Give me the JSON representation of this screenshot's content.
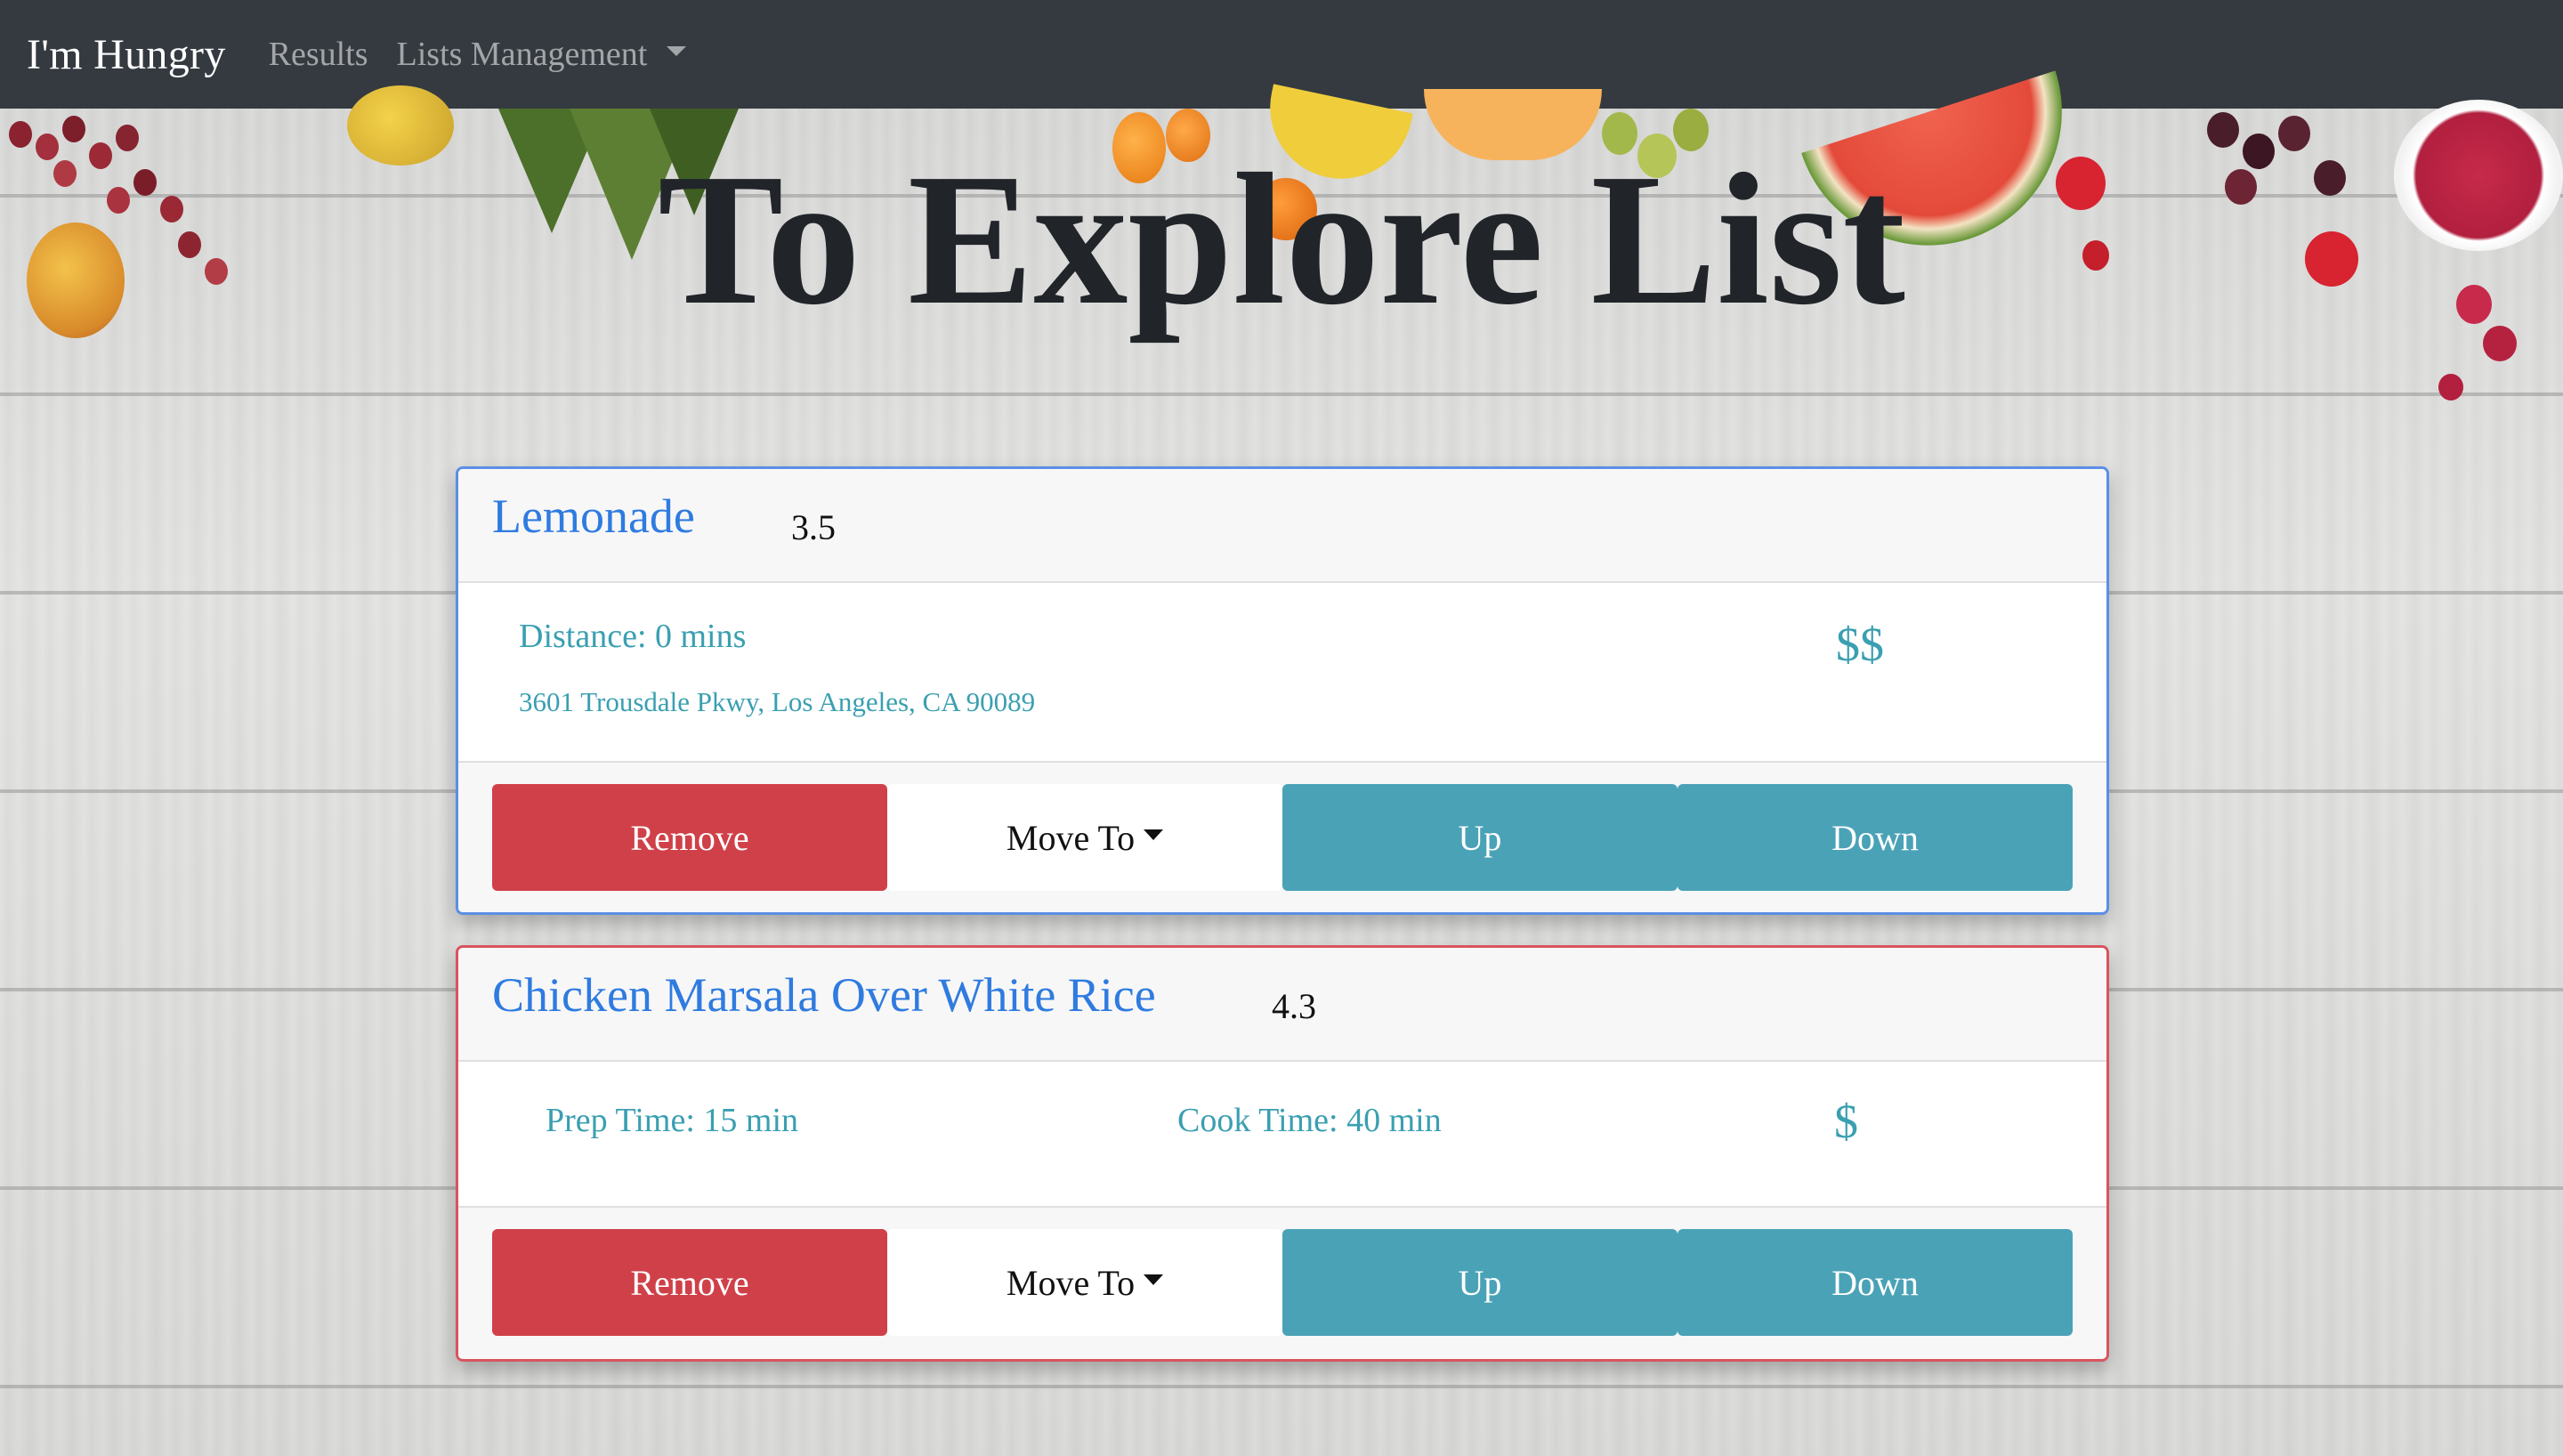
{
  "navbar": {
    "brand": "I'm Hungry",
    "links": [
      "Results",
      "Lists Management"
    ]
  },
  "page": {
    "title": "To Explore List"
  },
  "cards": [
    {
      "name": "Lemonade",
      "rating": "3.5",
      "distance": "Distance: 0 mins",
      "address": "3601 Trousdale Pkwy, Los Angeles, CA 90089",
      "price": "$$"
    },
    {
      "name": "Chicken Marsala Over White Rice",
      "rating": "4.3",
      "prep_time": "Prep Time: 15 min",
      "cook_time": "Cook Time: 40 min",
      "price": "$"
    }
  ],
  "actions": {
    "remove": "Remove",
    "move_to": "Move To",
    "up": "Up",
    "down": "Down"
  },
  "colors": {
    "navbar": "#343a40",
    "name_link": "#2f7be0",
    "teal_text": "#3a9fb1",
    "remove": "#d04048",
    "up_down": "#4aa2b7",
    "restaurant_border": "#5b8ee6",
    "recipe_border": "#d9545e"
  },
  "icons": [
    "chevron-down-icon"
  ]
}
